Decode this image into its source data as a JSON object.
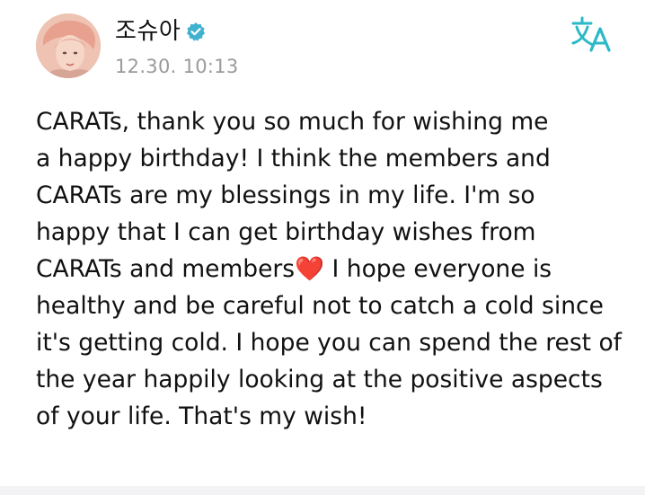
{
  "post": {
    "author": {
      "name": "조슈아",
      "verified_icon": "verified-badge-icon",
      "avatar_icon": "profile-avatar"
    },
    "timestamp": "12.30. 10:13",
    "translate_icon": "translate-icon",
    "body_lines": [
      "CARATs, thank you so much for wishing me",
      "a happy birthday! I think the members and",
      "CARATs are my blessings in my life. I'm so",
      "happy that I can get birthday wishes from",
      "CARATs and members",
      " I hope everyone is",
      "healthy and be careful not to catch a cold since",
      "it's getting cold. I hope you can spend the rest of",
      "the year happily looking at the positive aspects",
      "of your life. That's my wish!"
    ],
    "heart_emoji": "❤️"
  },
  "colors": {
    "accent": "#2bb9c8",
    "verified": "#3fb2cf",
    "timestamp": "#9a9a9a",
    "text": "#111111",
    "heart": "#e03131"
  }
}
